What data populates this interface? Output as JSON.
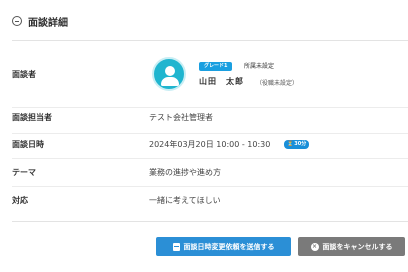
{
  "section": {
    "title": "面談詳細"
  },
  "rows": {
    "interviewee_label": "面談者",
    "staff_label": "面談担当者",
    "staff_value": "テスト会社管理者",
    "datetime_label": "面談日時",
    "datetime_value": "2024年03月20日 10:00 - 10:30",
    "duration_badge": "30分",
    "theme_label": "テーマ",
    "theme_value": "業務の進捗や進め方",
    "response_label": "対応",
    "response_value": "一緒に考えてほしい"
  },
  "interviewee": {
    "grade_badge": "グレード1",
    "department": "所属未設定",
    "name": "山田　太郎",
    "role": "（役職未設定）"
  },
  "buttons": {
    "request_change_label": "面談日時変更依頼を送信する",
    "cancel_label": "面談をキャンセルする"
  },
  "colors": {
    "primary": "#2b8fd6",
    "secondary": "#7a7a7a",
    "avatar": "#20b5cf",
    "badge": "#1a9fe0"
  },
  "icons": {
    "collapse": "minus-circle-icon",
    "avatar": "user-avatar-icon",
    "duration": "hourglass-icon",
    "request": "document-icon",
    "cancel": "x-circle-icon"
  }
}
